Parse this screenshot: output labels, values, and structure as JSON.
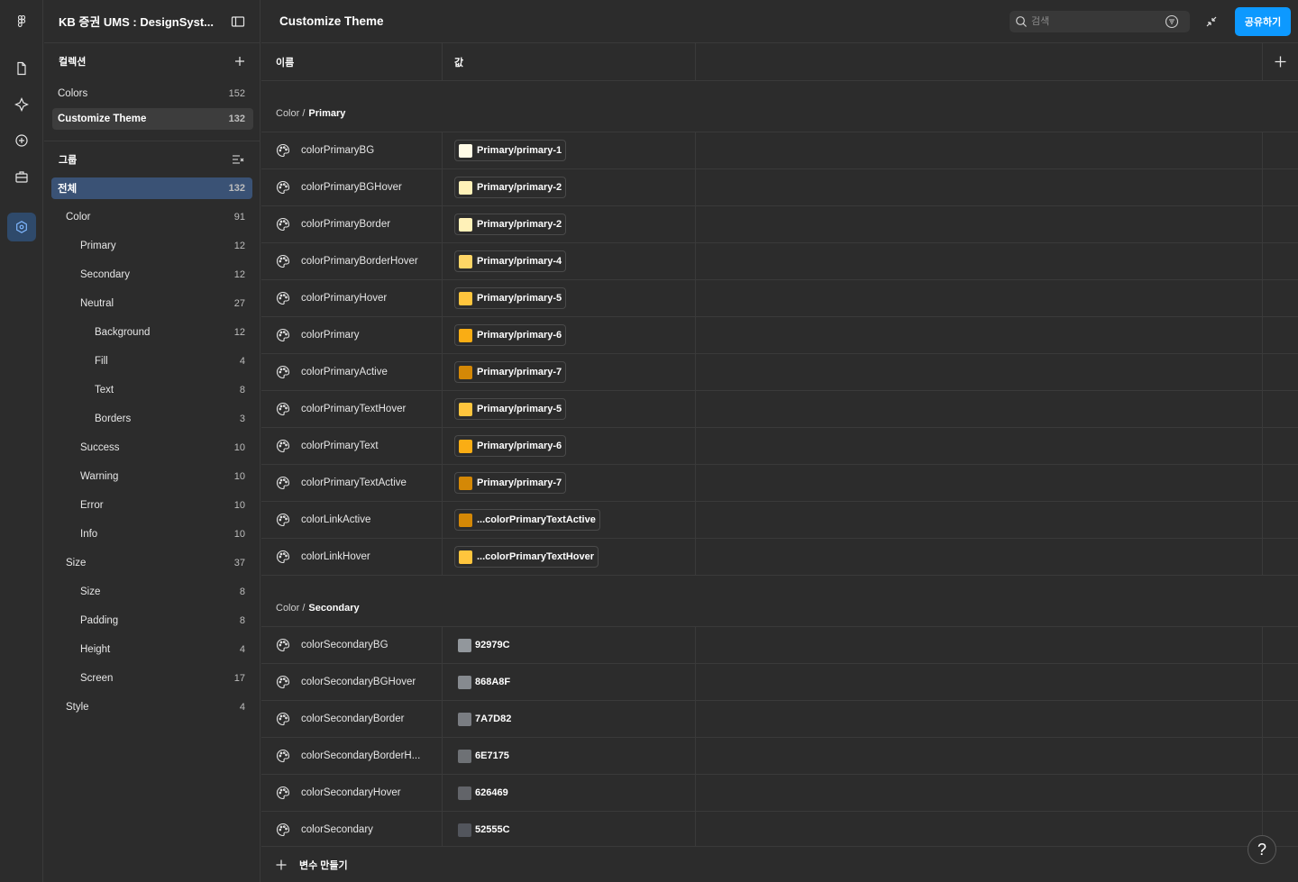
{
  "app": {
    "file_title": "KB 증권 UMS : DesignSyst..."
  },
  "collections": {
    "header": "컬렉션",
    "items": [
      {
        "label": "Colors",
        "count": "152"
      },
      {
        "label": "Customize Theme",
        "count": "132"
      }
    ]
  },
  "groups": {
    "header": "그룹",
    "items": [
      {
        "label": "전체",
        "count": "132",
        "level": 0
      },
      {
        "label": "Color",
        "count": "91",
        "level": 1
      },
      {
        "label": "Primary",
        "count": "12",
        "level": 2
      },
      {
        "label": "Secondary",
        "count": "12",
        "level": 2
      },
      {
        "label": "Neutral",
        "count": "27",
        "level": 2
      },
      {
        "label": "Background",
        "count": "12",
        "level": 3
      },
      {
        "label": "Fill",
        "count": "4",
        "level": 3
      },
      {
        "label": "Text",
        "count": "8",
        "level": 3
      },
      {
        "label": "Borders",
        "count": "3",
        "level": 3
      },
      {
        "label": "Success",
        "count": "10",
        "level": 2
      },
      {
        "label": "Warning",
        "count": "10",
        "level": 2
      },
      {
        "label": "Error",
        "count": "10",
        "level": 2
      },
      {
        "label": "Info",
        "count": "10",
        "level": 2
      },
      {
        "label": "Size",
        "count": "37",
        "level": 1
      },
      {
        "label": "Size",
        "count": "8",
        "level": 2
      },
      {
        "label": "Padding",
        "count": "8",
        "level": 2
      },
      {
        "label": "Height",
        "count": "4",
        "level": 2
      },
      {
        "label": "Screen",
        "count": "17",
        "level": 2
      },
      {
        "label": "Style",
        "count": "4",
        "level": 1
      }
    ]
  },
  "topbar": {
    "title": "Customize Theme",
    "search_placeholder": "검색",
    "share_label": "공유하기"
  },
  "table": {
    "col_name": "이름",
    "col_value": "값",
    "primary_group": {
      "prefix": "Color /",
      "name": "Primary"
    },
    "primary_rows": [
      {
        "name": "colorPrimaryBG",
        "value": "Primary/primary-1",
        "color": "#fffbe6"
      },
      {
        "name": "colorPrimaryBGHover",
        "value": "Primary/primary-2",
        "color": "#fff1b8"
      },
      {
        "name": "colorPrimaryBorder",
        "value": "Primary/primary-2",
        "color": "#fff1b8"
      },
      {
        "name": "colorPrimaryBorderHover",
        "value": "Primary/primary-4",
        "color": "#ffd666"
      },
      {
        "name": "colorPrimaryHover",
        "value": "Primary/primary-5",
        "color": "#ffc53d"
      },
      {
        "name": "colorPrimary",
        "value": "Primary/primary-6",
        "color": "#faad14"
      },
      {
        "name": "colorPrimaryActive",
        "value": "Primary/primary-7",
        "color": "#d48806"
      },
      {
        "name": "colorPrimaryTextHover",
        "value": "Primary/primary-5",
        "color": "#ffc53d"
      },
      {
        "name": "colorPrimaryText",
        "value": "Primary/primary-6",
        "color": "#faad14"
      },
      {
        "name": "colorPrimaryTextActive",
        "value": "Primary/primary-7",
        "color": "#d48806"
      },
      {
        "name": "colorLinkActive",
        "value": "...colorPrimaryTextActive",
        "color": "#d48806"
      },
      {
        "name": "colorLinkHover",
        "value": "...colorPrimaryTextHover",
        "color": "#ffc53d"
      }
    ],
    "secondary_group": {
      "prefix": "Color /",
      "name": "Secondary"
    },
    "secondary_rows": [
      {
        "name": "colorSecondaryBG",
        "value": "92979C",
        "color": "#92979C"
      },
      {
        "name": "colorSecondaryBGHover",
        "value": "868A8F",
        "color": "#868A8F"
      },
      {
        "name": "colorSecondaryBorder",
        "value": "7A7D82",
        "color": "#7A7D82"
      },
      {
        "name": "colorSecondaryBorderH...",
        "value": "6E7175",
        "color": "#6E7175"
      },
      {
        "name": "colorSecondaryHover",
        "value": "626469",
        "color": "#626469"
      },
      {
        "name": "colorSecondary",
        "value": "52555C",
        "color": "#52555C"
      }
    ]
  },
  "footer": {
    "new_variable_label": "변수 만들기",
    "help_label": "?"
  },
  "colors": {
    "accent": "#0d99ff",
    "selected": "#3a5275"
  }
}
